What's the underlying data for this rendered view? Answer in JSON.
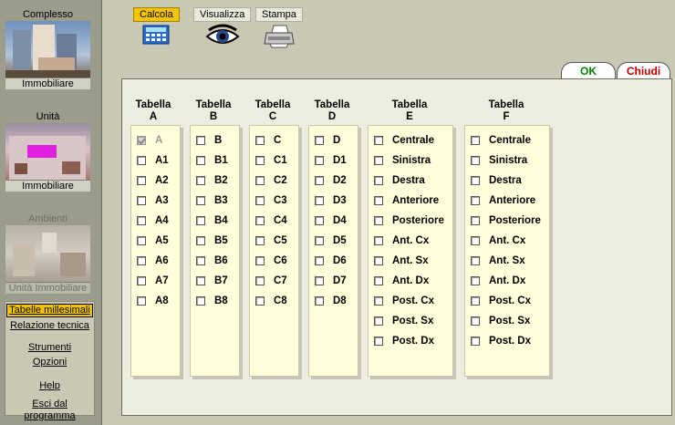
{
  "sidebar": {
    "cards": [
      {
        "top": "Complesso",
        "bottom": "Immobiliare"
      },
      {
        "top": "Unità",
        "bottom": "Immobiliare"
      },
      {
        "top": "Ambienti",
        "bottom": "Unità Immobiliare"
      }
    ],
    "menu": [
      {
        "label": "Tabelle millesimali",
        "active": true
      },
      {
        "label": "Relazione tecnica"
      },
      {
        "label": "Strumenti"
      },
      {
        "label": "Opzioni"
      },
      {
        "label": "Help"
      },
      {
        "label": "Esci dal programma"
      }
    ]
  },
  "toolbar": {
    "calcola": "Calcola",
    "visualizza": "Visualizza",
    "stampa": "Stampa"
  },
  "tabs": {
    "ok": "OK",
    "chiudi": "Chiudi"
  },
  "columns": [
    {
      "head1": "Tabella",
      "head2": "A",
      "items": [
        "A",
        "A1",
        "A2",
        "A3",
        "A4",
        "A5",
        "A6",
        "A7",
        "A8"
      ]
    },
    {
      "head1": "Tabella",
      "head2": "B",
      "items": [
        "B",
        "B1",
        "B2",
        "B3",
        "B4",
        "B5",
        "B6",
        "B7",
        "B8"
      ]
    },
    {
      "head1": "Tabella",
      "head2": "C",
      "items": [
        "C",
        "C1",
        "C2",
        "C3",
        "C4",
        "C5",
        "C6",
        "C7",
        "C8"
      ]
    },
    {
      "head1": "Tabella",
      "head2": "D",
      "items": [
        "D",
        "D1",
        "D2",
        "D3",
        "D4",
        "D5",
        "D6",
        "D7",
        "D8"
      ]
    },
    {
      "head1": "Tabella",
      "head2": "E",
      "items": [
        "Centrale",
        "Sinistra",
        "Destra",
        "Anteriore",
        "Posteriore",
        "Ant. Cx",
        "Ant. Sx",
        "Ant. Dx",
        "Post. Cx",
        "Post. Sx",
        "Post. Dx"
      ]
    },
    {
      "head1": "Tabella",
      "head2": "F",
      "items": [
        "Centrale",
        "Sinistra",
        "Destra",
        "Anteriore",
        "Posteriore",
        "Ant. Cx",
        "Ant. Sx",
        "Ant. Dx",
        "Post. Cx",
        "Post. Sx",
        "Post. Dx"
      ]
    }
  ],
  "colors": {
    "accent": "#f5c400",
    "ok": "#008000",
    "chiudi": "#c00000"
  }
}
